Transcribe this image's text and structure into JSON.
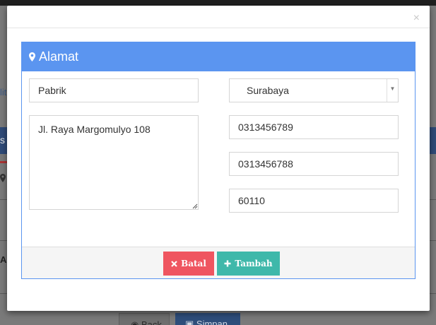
{
  "background": {
    "fragment_lit": "lit",
    "fragment_s": "s",
    "fragment_al": "Al",
    "back_label": "Back",
    "save_label": "Simpan",
    "brand_blue": "#2f4b78"
  },
  "modal": {
    "close_glyph": "×",
    "panel_title": "Alamat",
    "panel_icon": "map-marker-icon",
    "fields": {
      "name_value": "Pabrik",
      "city_value": "Surabaya",
      "address_value": "Jl. Raya Margomulyo 108",
      "phone1_value": "0313456789",
      "phone2_value": "0313456788",
      "zip_value": "60110"
    },
    "buttons": {
      "cancel_label": "Batal",
      "cancel_icon": "times-icon",
      "add_label": "Tambah",
      "add_icon": "plus-icon"
    }
  },
  "colors": {
    "panel_accent": "#5b95f0",
    "cancel": "#ef5560",
    "add": "#3fb8aa"
  }
}
